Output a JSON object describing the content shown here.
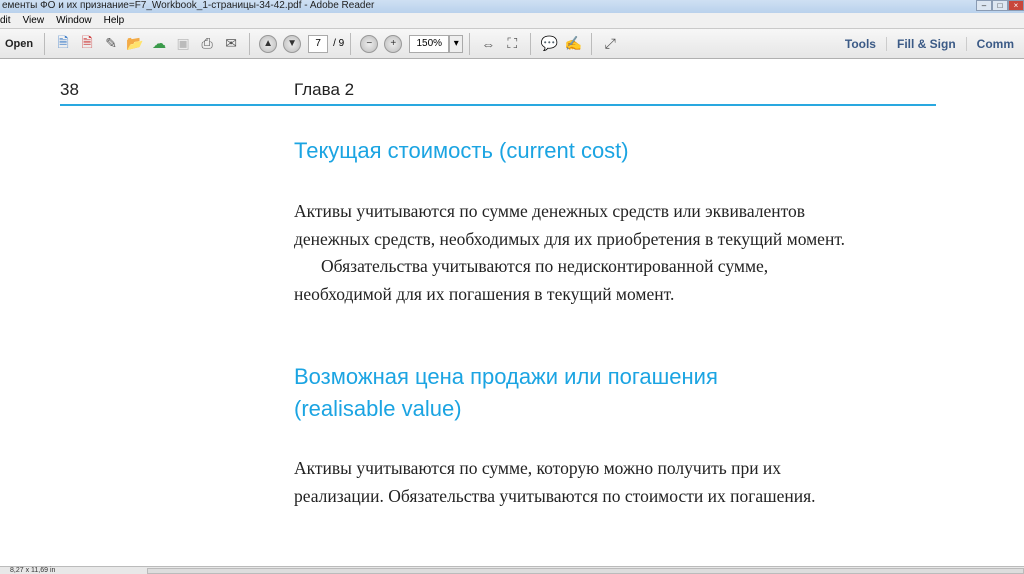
{
  "window": {
    "title": "ементы ФО и их признание=F7_Workbook_1-страницы-34-42.pdf - Adobe Reader"
  },
  "menu": [
    "dit",
    "View",
    "Window",
    "Help"
  ],
  "toolbar": {
    "open": "Open",
    "page_current": "7",
    "page_total": "/ 9",
    "zoom": "150%",
    "tools": "Tools",
    "fill_sign": "Fill & Sign",
    "comment": "Comm"
  },
  "document": {
    "page_number": "38",
    "chapter": "Глава 2",
    "heading1": "Текущая стоимость (current cost)",
    "para1": [
      "Активы учитываются по сумме денежных средств или эквивалентов",
      "денежных средств, необходимых для их приобретения в текущий момент.",
      "Обязательства учитываются по недисконтированной сумме,",
      "необходимой для их погашения в текущий момент."
    ],
    "heading2": [
      "Возможная цена продажи или погашения",
      "(realisable value)"
    ],
    "para2": [
      "Активы учитываются по сумме, которую можно получить при их",
      "реализации. Обязательства учитываются по стоимости их погашения."
    ]
  },
  "status": {
    "page_size": "8,27 x 11,69 in"
  }
}
